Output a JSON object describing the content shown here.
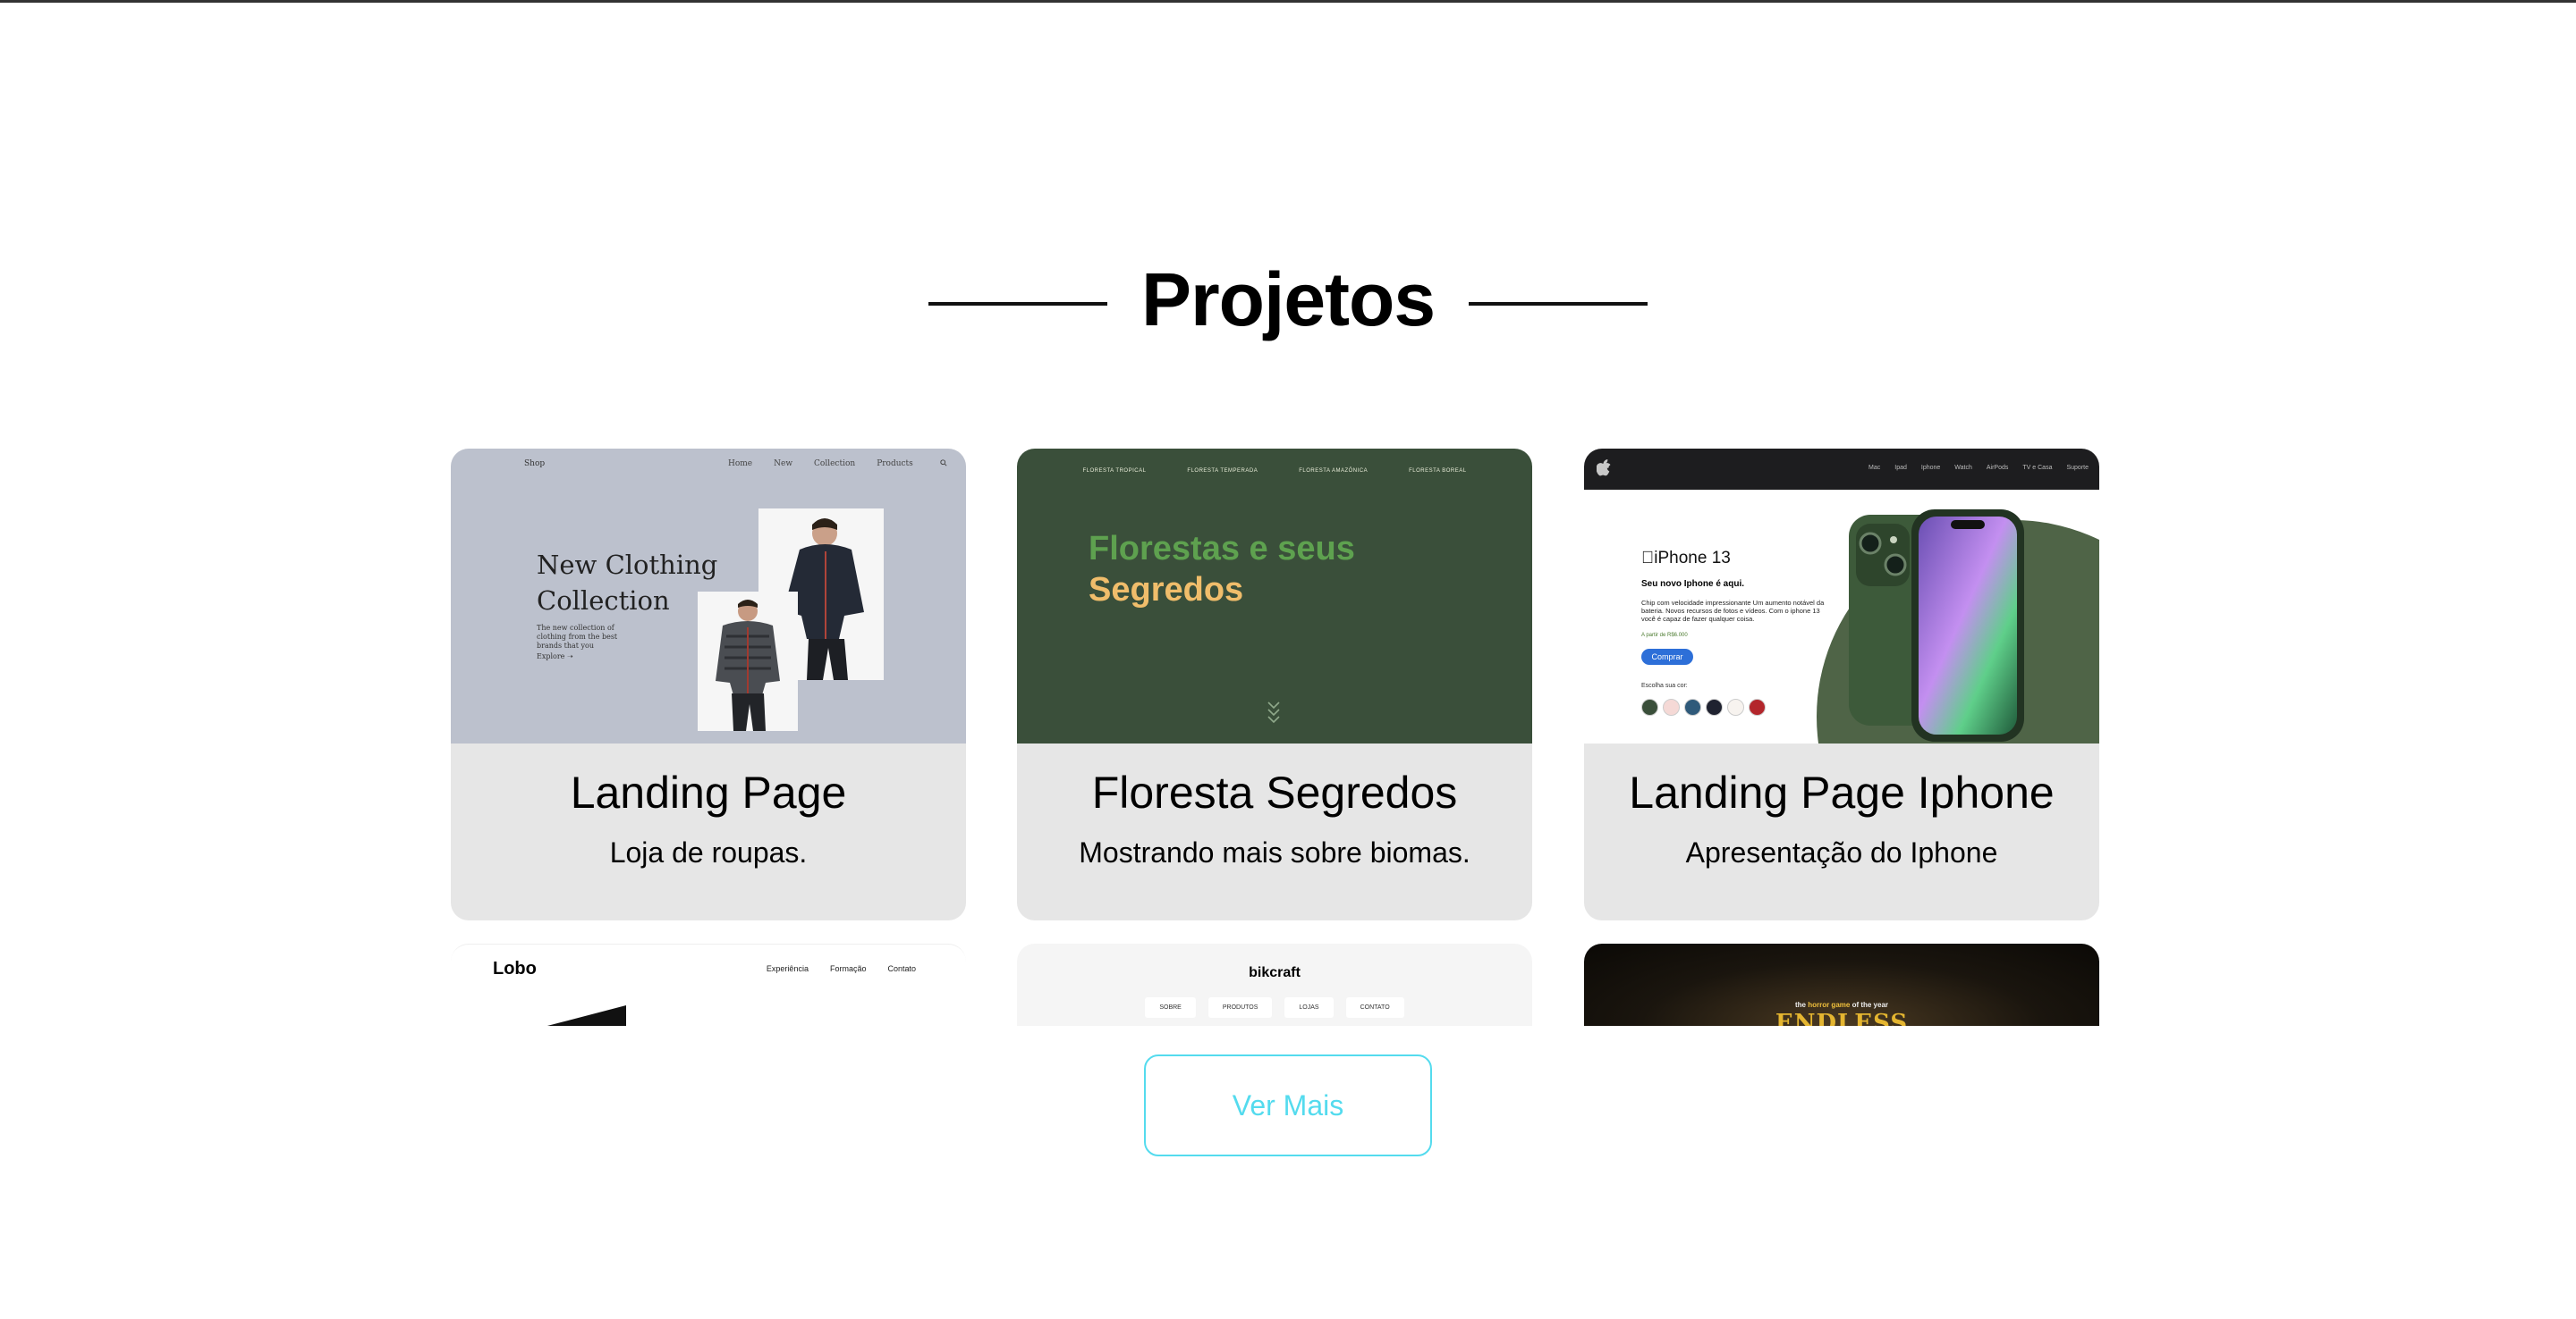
{
  "section": {
    "title": "Projetos"
  },
  "cards": [
    {
      "title": "Landing Page",
      "description": "Loja de roupas.",
      "preview": {
        "logo": "Shop",
        "nav": [
          "Home",
          "New",
          "Collection",
          "Products"
        ],
        "hero_title": "New Clothing Collection",
        "hero_sub": "The new collection of clothing from the best brands that you",
        "cta": "Explore"
      }
    },
    {
      "title": "Floresta Segredos",
      "description": "Mostrando mais sobre biomas.",
      "preview": {
        "nav": [
          "FLORESTA TROPICAL",
          "FLORESTA TEMPERADA",
          "FLORESTA AMAZÔNICA",
          "FLORESTA BOREAL"
        ],
        "headline_1": "Florestas e seus",
        "headline_2": "Segredos"
      }
    },
    {
      "title": "Landing Page Iphone",
      "description": "Apresentação do Iphone",
      "preview": {
        "nav": [
          "Mac",
          "Ipad",
          "Iphone",
          "Watch",
          "AirPods",
          "TV e Casa",
          "Suporte"
        ],
        "product": "iPhone 13",
        "tagline": "Seu novo Iphone é aqui.",
        "text": "Chip com velocidade impressionante Um aumento notável da bateria. Novos recursos de fotos e vídeos. Com o iphone 13 você é capaz de fazer qualquer coisa.",
        "price": "A partir de R$6.000",
        "buy_label": "Comprar",
        "pick_label": "Escolha sua cor:",
        "swatches": [
          "#3a4f3a",
          "#f5d9d6",
          "#2f5a7a",
          "#1f2230",
          "#f7f3ef",
          "#b3262b"
        ]
      }
    }
  ],
  "partial_cards": [
    {
      "logo": "Lobo",
      "nav": [
        "Experiência",
        "Formação",
        "Contato"
      ]
    },
    {
      "logo": "bikcraft",
      "menu": [
        "SOBRE",
        "PRODUTOS",
        "LOJAS",
        "CONTATO"
      ]
    },
    {
      "tag_pre": "the",
      "tag_highlight": "horror game",
      "tag_post": "of the year",
      "title": "ENDLESS"
    }
  ],
  "more_button": {
    "label": "Ver Mais"
  },
  "colors": {
    "accent": "#54dbee",
    "card_bg": "#e6e6e6"
  }
}
